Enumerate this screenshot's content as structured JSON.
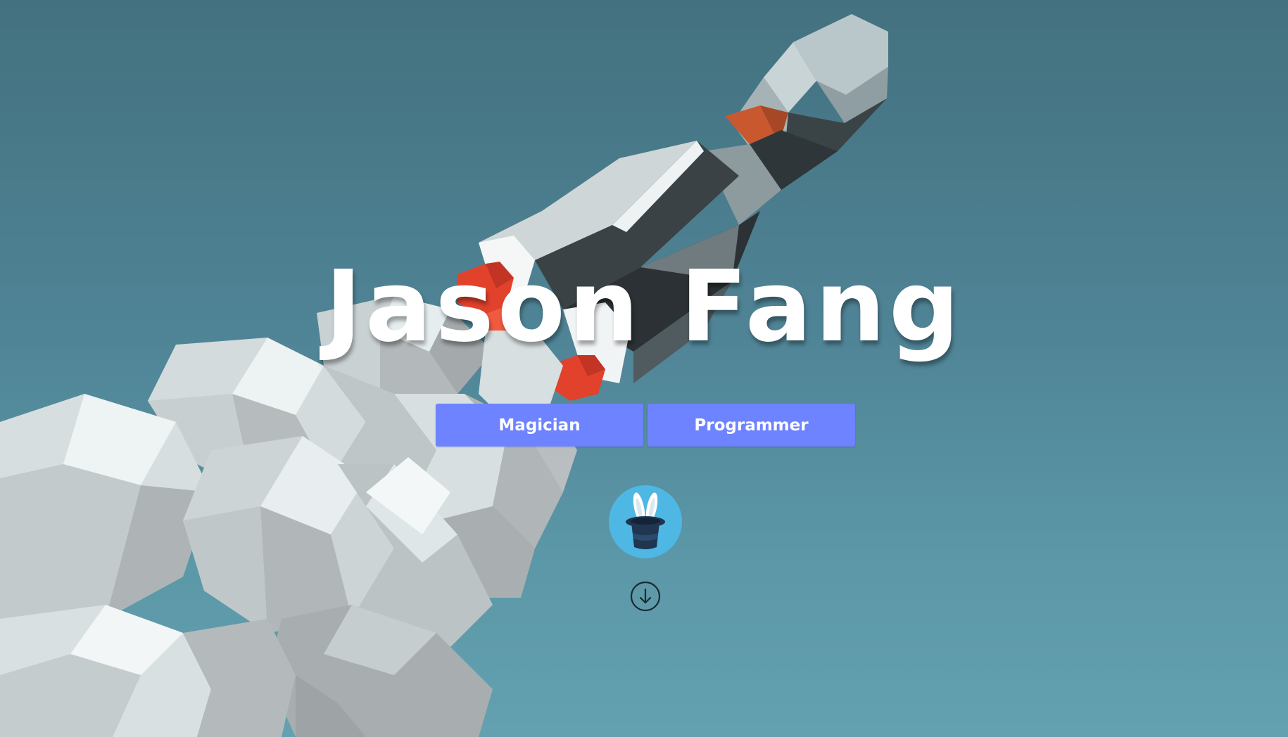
{
  "hero": {
    "title": "Jason Fang"
  },
  "buttons": {
    "magician_label": "Magician",
    "programmer_label": "Programmer"
  },
  "icons": {
    "logo": "magic-hat-bunny-icon",
    "scroll": "arrow-down-circle-icon"
  },
  "colors": {
    "button_bg": "#6e83ff",
    "button_text": "#ffffff",
    "title_text": "#ffffff",
    "logo_bg": "#4fb7e3",
    "hat": "#1f3550",
    "sky_top": "#43717f",
    "sky_bottom": "#64a1b0"
  }
}
